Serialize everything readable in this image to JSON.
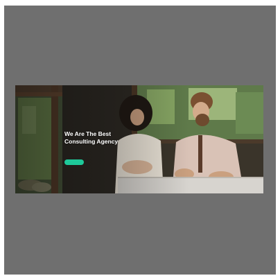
{
  "hero": {
    "title": "We Are The Best\nConsulting Agency",
    "description": "",
    "cta_label": ""
  },
  "colors": {
    "frame_background": "#6f6f6f",
    "cta_accent": "#1ec99a"
  }
}
